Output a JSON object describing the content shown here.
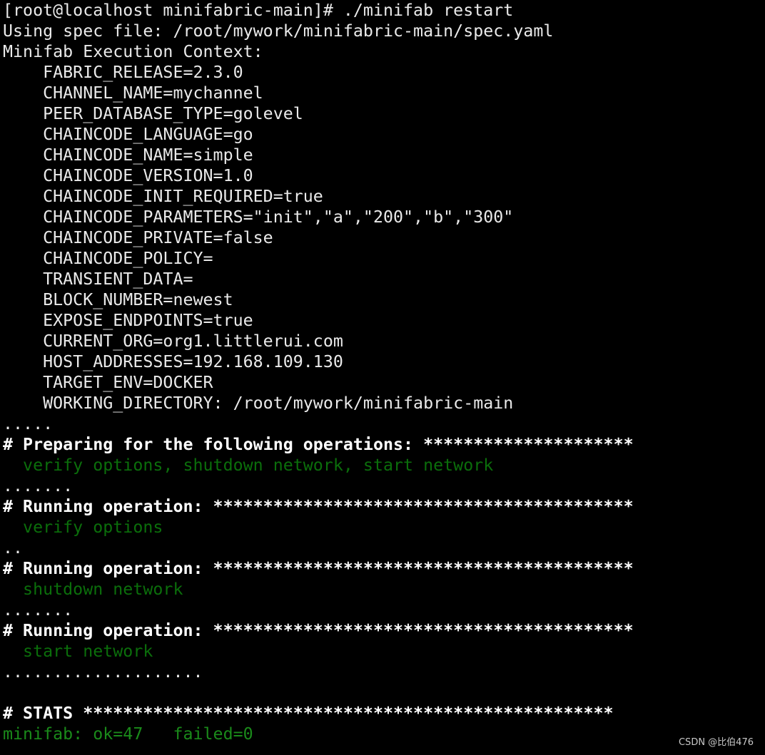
{
  "terminal": {
    "lines": [
      {
        "text": "[root@localhost minifabric-main]# ./minifab restart",
        "style": "white"
      },
      {
        "text": "Using spec file: /root/mywork/minifabric-main/spec.yaml",
        "style": "white"
      },
      {
        "text": "Minifab Execution Context:",
        "style": "white"
      },
      {
        "text": "    FABRIC_RELEASE=2.3.0",
        "style": "white"
      },
      {
        "text": "    CHANNEL_NAME=mychannel",
        "style": "white"
      },
      {
        "text": "    PEER_DATABASE_TYPE=golevel",
        "style": "white"
      },
      {
        "text": "    CHAINCODE_LANGUAGE=go",
        "style": "white"
      },
      {
        "text": "    CHAINCODE_NAME=simple",
        "style": "white"
      },
      {
        "text": "    CHAINCODE_VERSION=1.0",
        "style": "white"
      },
      {
        "text": "    CHAINCODE_INIT_REQUIRED=true",
        "style": "white"
      },
      {
        "text": "    CHAINCODE_PARAMETERS=\"init\",\"a\",\"200\",\"b\",\"300\"",
        "style": "white"
      },
      {
        "text": "    CHAINCODE_PRIVATE=false",
        "style": "white"
      },
      {
        "text": "    CHAINCODE_POLICY=",
        "style": "white"
      },
      {
        "text": "    TRANSIENT_DATA=",
        "style": "white"
      },
      {
        "text": "    BLOCK_NUMBER=newest",
        "style": "white"
      },
      {
        "text": "    EXPOSE_ENDPOINTS=true",
        "style": "white"
      },
      {
        "text": "    CURRENT_ORG=org1.littlerui.com",
        "style": "white"
      },
      {
        "text": "    HOST_ADDRESSES=192.168.109.130",
        "style": "white"
      },
      {
        "text": "    TARGET_ENV=DOCKER",
        "style": "white"
      },
      {
        "text": "    WORKING_DIRECTORY: /root/mywork/minifabric-main",
        "style": "white"
      },
      {
        "text": ".....",
        "style": "white"
      },
      {
        "text": "# Preparing for the following operations: *********************",
        "style": "bold"
      },
      {
        "text": "  verify options, shutdown network, start network",
        "style": "green"
      },
      {
        "text": ".......",
        "style": "white"
      },
      {
        "text": "# Running operation: ******************************************",
        "style": "bold"
      },
      {
        "text": "  verify options",
        "style": "green"
      },
      {
        "text": "..",
        "style": "white"
      },
      {
        "text": "# Running operation: ******************************************",
        "style": "bold"
      },
      {
        "text": "  shutdown network",
        "style": "green"
      },
      {
        "text": ".......",
        "style": "white"
      },
      {
        "text": "# Running operation: ******************************************",
        "style": "bold"
      },
      {
        "text": "  start network",
        "style": "green"
      },
      {
        "text": "....................",
        "style": "white"
      },
      {
        "text": "",
        "style": "white"
      },
      {
        "text": "# STATS *****************************************************",
        "style": "bold"
      },
      {
        "text": "minifab: ok=47   failed=0",
        "style": "green-bright"
      }
    ]
  },
  "watermark": "CSDN @比伯476",
  "colors": {
    "background": "#000000",
    "text": "#eaeaea",
    "green": "#0b6e0b",
    "green_bright": "#1a8a1a"
  }
}
